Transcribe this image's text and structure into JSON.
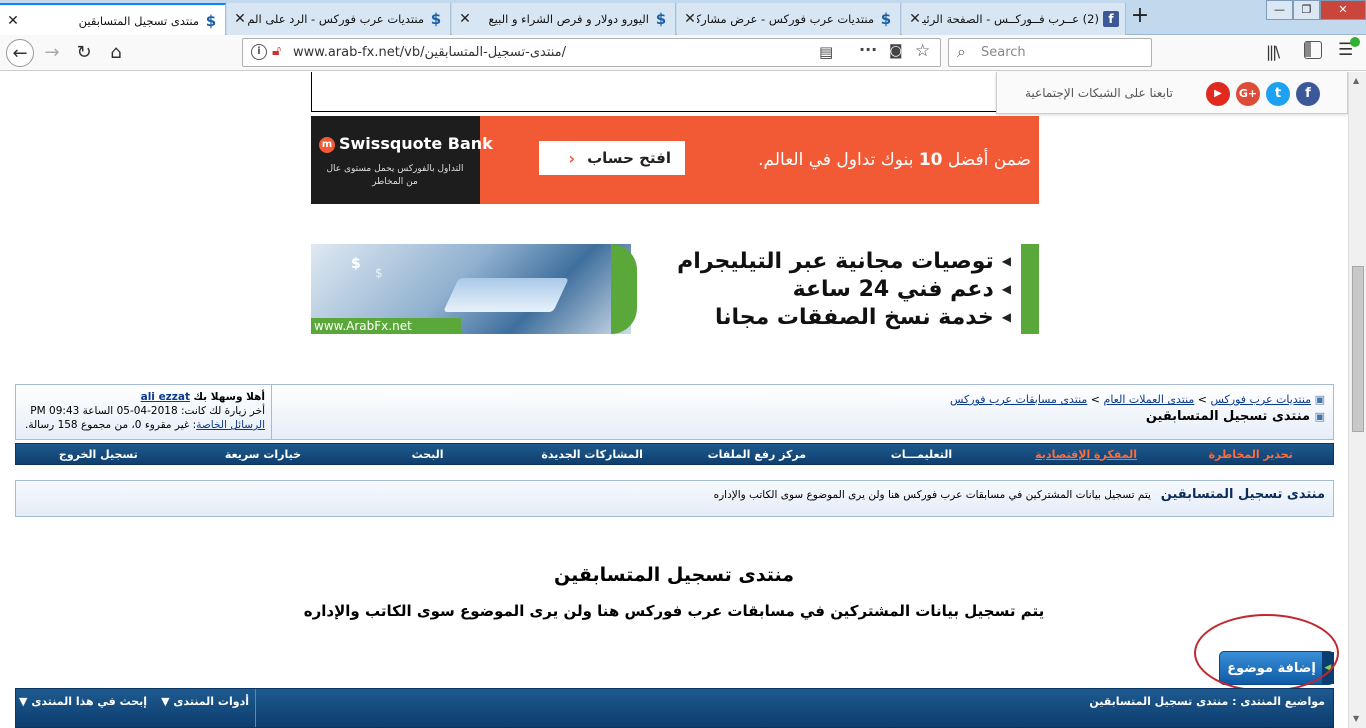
{
  "tabs": [
    {
      "title": "منتدى تسجيل المتسابقين",
      "active": true
    },
    {
      "title": "منتديات عرب فوركس - الرد على الم",
      "active": false
    },
    {
      "title": "اليورو دولار و فرص الشراء و البيع",
      "active": false
    },
    {
      "title": "منتديات عرب فوركس - عرض مشاركة",
      "active": false
    },
    {
      "title": "(2) عــرب فــوركــس - الصفحة الرئيسة",
      "active": false
    }
  ],
  "browser": {
    "url": "www.arab-fx.net/vb/منتدى-تسجيل-المتسابقين/",
    "search_placeholder": "Search"
  },
  "social": {
    "label": "تابعنا على الشبكات الإجتماعية"
  },
  "ad1": {
    "brand": "Swissquote Bank",
    "brand_sub1": "التداول بالفوركس يحمل مستوى عال",
    "brand_sub2": "من المخاطر",
    "button": "افتح حساب",
    "tagline_pre": "ضمن أفضل",
    "tagline_num": "10",
    "tagline_post": "بنوك تداول في العالم."
  },
  "ad2": {
    "line1": "توصيات مجانية عبر التيليجرام",
    "line2": "دعم فني 24 ساعة",
    "line3": "خدمة نسخ الصفقات مجانا",
    "site": "www.ArabFx.net"
  },
  "breadcrumb": {
    "home": "منتديات عرب فوركس",
    "level2": "منتدى العملات العام",
    "level3": "منتدى مسابقات عرب فوركس",
    "current": "منتدى تسجيل المتسابقين"
  },
  "user": {
    "welcome": "أهلا وسهلا بك",
    "username": "ali ezzat",
    "last_visit": "أخر زيارة لك كانت: 2018-04-05 الساعة 09:43 PM",
    "pm_link": "الرسائل الخاصة",
    "pm_text": ": غير مقروء 0، من مجموع 158 رسالة."
  },
  "menu": [
    "تحذير المخاطرة",
    "المفكرة الإقتصادية",
    "التعليمـــات",
    "مركز رفع الملفات",
    "المشاركات الجديدة",
    "البحث",
    "خيارات سريعة",
    "تسجيل الخروج"
  ],
  "forum_desc": {
    "title": "منتدى تسجيل المتسابقين",
    "text": "يتم تسجيل بيانات المشتركين في مسابقات عرب فوركس هنا ولن يرى الموضوع سوى الكاتب والإداره"
  },
  "main": {
    "title": "منتدى تسجيل المتسابقين",
    "subtitle": "يتم تسجيل بيانات المشتركين في مسابقات عرب فوركس هنا ولن يرى الموضوع سوى الكاتب والإداره",
    "new_topic": "إضافة موضوع"
  },
  "bottom": {
    "title": "مواضيع المنتدى : منتدى تسجيل المتسابقين",
    "tools": "أدوات المنتدى",
    "search": "إبحث في هذا المنتدى"
  },
  "colors": {
    "accent": "#0f3f6e",
    "ad_orange": "#f25a35",
    "ad_green": "#5aa83a",
    "highlight_red": "#c0282d"
  }
}
